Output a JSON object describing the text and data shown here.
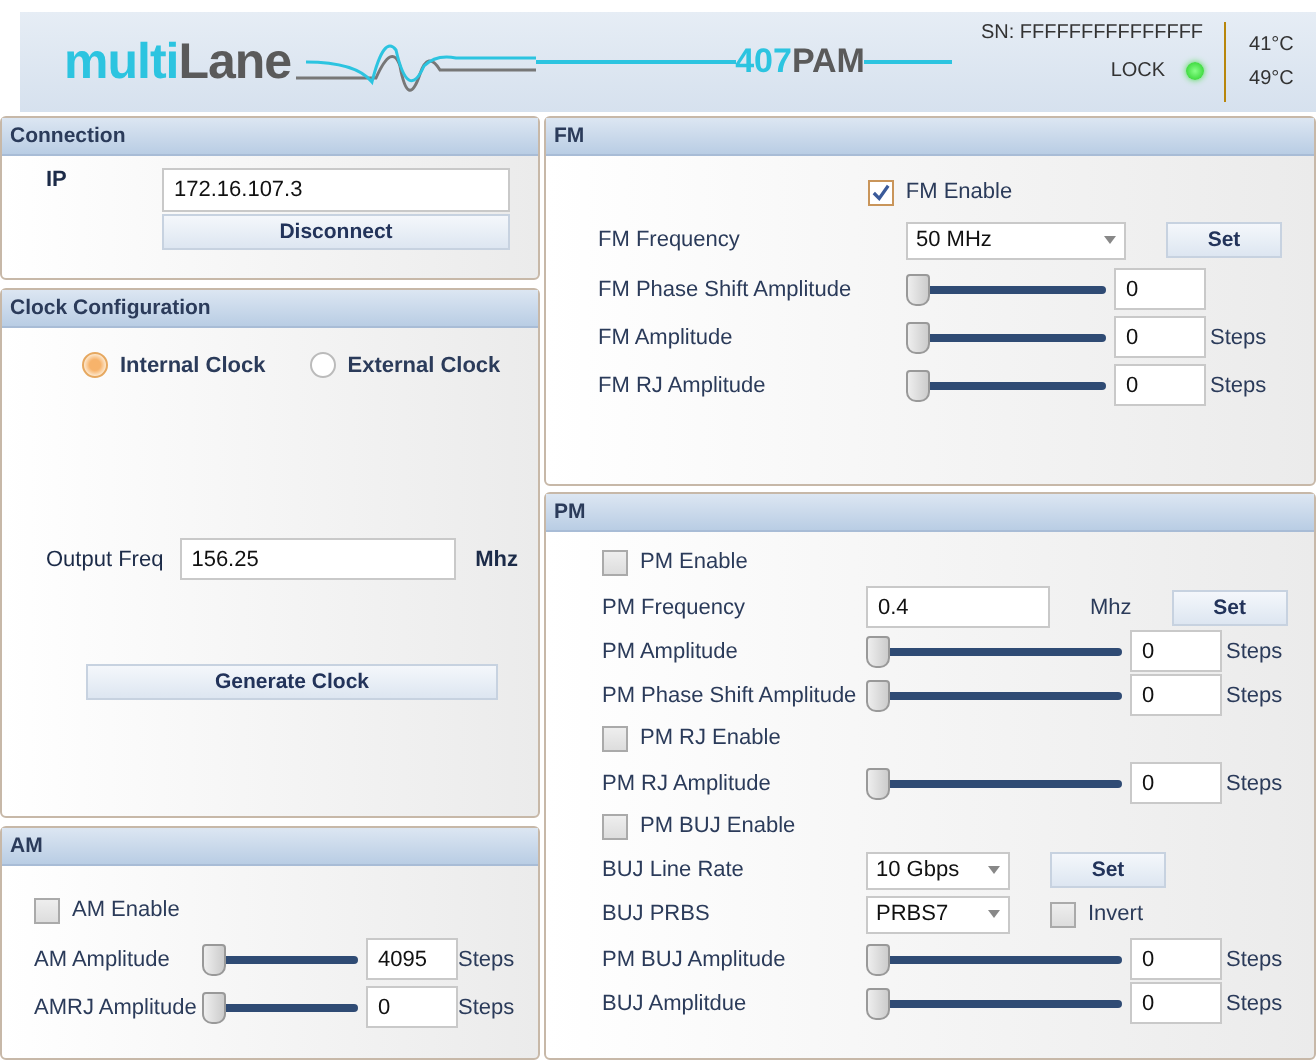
{
  "header": {
    "logo_prefix": "multi",
    "logo_suffix": "Lane",
    "model_number": "407",
    "model_name": "PAM",
    "serial": "SN: FFFFFFFFFFFFFFF",
    "lock_label": "LOCK",
    "locked": true,
    "temperatures": [
      "41°C",
      "49°C"
    ]
  },
  "connection": {
    "title": "Connection",
    "ip_label": "IP",
    "ip": "172.16.107.3",
    "button": "Disconnect"
  },
  "clock": {
    "title": "Clock Configuration",
    "sources": [
      {
        "label": "Internal Clock",
        "selected": true
      },
      {
        "label": "External Clock",
        "selected": false
      }
    ],
    "output_label": "Output Freq",
    "output_value": "156.25",
    "unit": "Mhz",
    "button": "Generate Clock"
  },
  "am": {
    "title": "AM",
    "rows": [
      {
        "kind": "checkbox",
        "label": "AM Enable",
        "checked": false
      },
      {
        "kind": "slider",
        "label": "AM Amplitude",
        "level": 0,
        "value": "4095",
        "unit": "Steps"
      },
      {
        "kind": "slider",
        "label": "AMRJ Amplitude",
        "level": 0,
        "value": "0",
        "unit": "Steps"
      }
    ]
  },
  "fm": {
    "title": "FM",
    "rows": [
      {
        "kind": "checkbox",
        "label": "FM Enable",
        "checked": true
      },
      {
        "kind": "dropdown",
        "label": "FM Frequency",
        "value": "50 MHz",
        "button": "Set"
      },
      {
        "kind": "slider",
        "label": "FM Phase Shift Amplitude",
        "level": 0,
        "value": "0"
      },
      {
        "kind": "slider",
        "label": "FM Amplitude",
        "level": 0,
        "value": "0",
        "unit": "Steps"
      },
      {
        "kind": "slider",
        "label": "FM RJ Amplitude",
        "level": 0,
        "value": "0",
        "unit": "Steps"
      }
    ]
  },
  "pm": {
    "title": "PM",
    "rows": [
      {
        "kind": "checkbox",
        "label": "PM Enable",
        "checked": false
      },
      {
        "kind": "text",
        "label": "PM Frequency",
        "value": "0.4",
        "unit": "Mhz",
        "button": "Set"
      },
      {
        "kind": "slider",
        "label": "PM Amplitude",
        "level": 0,
        "value": "0",
        "unit": "Steps"
      },
      {
        "kind": "slider",
        "label": "PM Phase Shift Amplitude",
        "level": 0,
        "value": "0",
        "unit": "Steps"
      },
      {
        "kind": "checkbox",
        "label": "PM RJ Enable",
        "checked": false
      },
      {
        "kind": "slider",
        "label": "PM RJ Amplitude",
        "level": 0,
        "value": "0",
        "unit": "Steps"
      },
      {
        "kind": "checkbox",
        "label": "PM BUJ Enable",
        "checked": false
      },
      {
        "kind": "dropdown",
        "label": "BUJ Line Rate",
        "value": "10 Gbps",
        "button": "Set"
      },
      {
        "kind": "dropdown",
        "label": "BUJ PRBS",
        "value": "PRBS7",
        "option": {
          "label": "Invert",
          "checked": false
        }
      },
      {
        "kind": "slider",
        "label": "PM BUJ Amplitude",
        "level": 0,
        "value": "0",
        "unit": "Steps"
      },
      {
        "kind": "slider",
        "label": "BUJ Amplitdue",
        "level": 0,
        "value": "0",
        "unit": "Steps"
      }
    ]
  }
}
